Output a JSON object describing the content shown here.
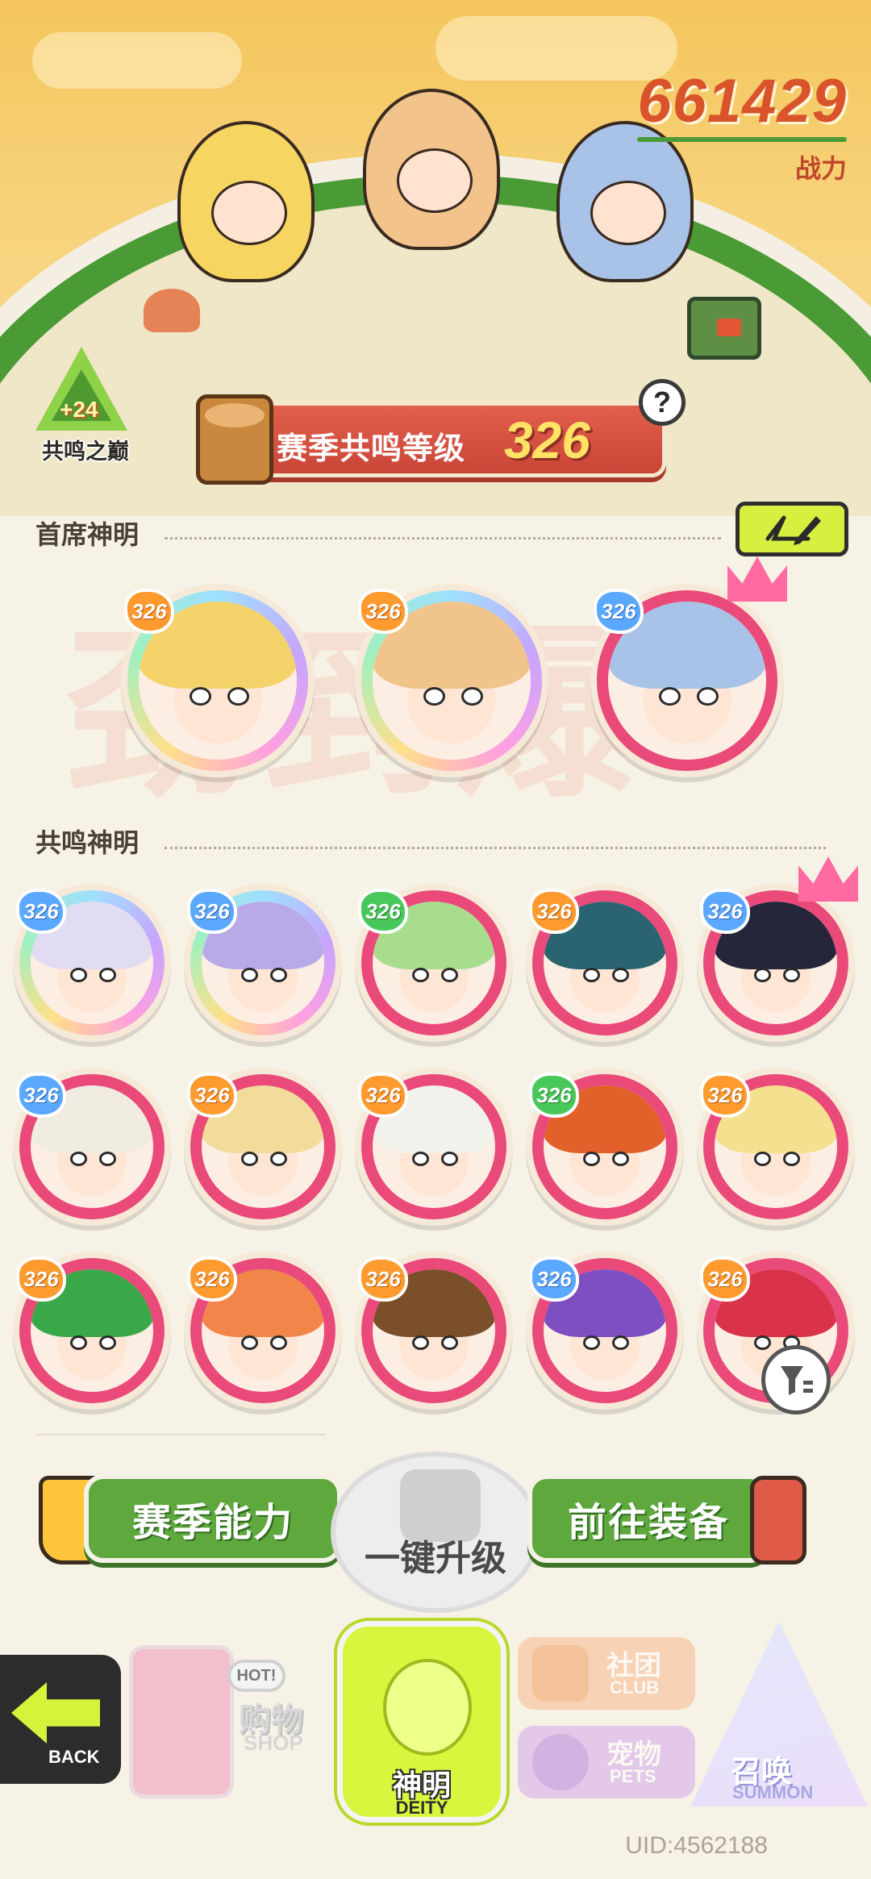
{
  "header": {
    "combat_power": "661429",
    "combat_power_label": "战力",
    "peak_badge_bonus": "+24",
    "peak_badge_label": "共鸣之巅",
    "resonance_label": "赛季共鸣等级",
    "resonance_level": "326",
    "help_symbol": "?"
  },
  "sections": {
    "chief_title": "首席神明",
    "resonance_title": "共鸣神明",
    "watermark": "劲到爆"
  },
  "chief_cards": [
    {
      "level": "326",
      "style": "rainbow",
      "badge": "orange",
      "hair": "#f4d36b",
      "crown": false
    },
    {
      "level": "326",
      "style": "rainbow",
      "badge": "orange",
      "hair": "#f0c48a",
      "crown": false
    },
    {
      "level": "326",
      "style": "pink",
      "badge": "blue",
      "hair": "#a9c3e8",
      "crown": true
    }
  ],
  "resonance_cards": [
    {
      "level": "326",
      "style": "rainbow",
      "badge": "blue",
      "hair": "#e2dcf2",
      "crown": false
    },
    {
      "level": "326",
      "style": "rainbow",
      "badge": "blue",
      "hair": "#b9a9e6",
      "crown": false
    },
    {
      "level": "326",
      "style": "pink",
      "badge": "green",
      "hair": "#a8dd8e",
      "crown": false
    },
    {
      "level": "326",
      "style": "pink",
      "badge": "orange",
      "hair": "#2a6470",
      "crown": false
    },
    {
      "level": "326",
      "style": "pink",
      "badge": "blue",
      "hair": "#25263a",
      "crown": true
    },
    {
      "level": "326",
      "style": "pink",
      "badge": "blue",
      "hair": "#f0ece2",
      "crown": false
    },
    {
      "level": "326",
      "style": "pink",
      "badge": "orange",
      "hair": "#f1dc9c",
      "crown": false
    },
    {
      "level": "326",
      "style": "pink",
      "badge": "orange",
      "hair": "#f2f2ec",
      "crown": false
    },
    {
      "level": "326",
      "style": "pink",
      "badge": "green",
      "hair": "#e2612a",
      "crown": false
    },
    {
      "level": "326",
      "style": "pink",
      "badge": "orange",
      "hair": "#f4e08f",
      "crown": false
    },
    {
      "level": "326",
      "style": "pink",
      "badge": "orange",
      "hair": "#3aa848",
      "crown": false
    },
    {
      "level": "326",
      "style": "pink",
      "badge": "orange",
      "hair": "#f2854a",
      "crown": false
    },
    {
      "level": "326",
      "style": "pink",
      "badge": "orange",
      "hair": "#7a4f2a",
      "crown": false
    },
    {
      "level": "326",
      "style": "pink",
      "badge": "blue",
      "hair": "#7d4fc0",
      "crown": false
    },
    {
      "level": "326",
      "style": "pink",
      "badge": "orange",
      "hair": "#d9324a",
      "crown": false
    }
  ],
  "actions": {
    "season_ability": "赛季能力",
    "one_click_upgrade": "一键升级",
    "go_equip": "前往装备"
  },
  "nav": {
    "back": "BACK",
    "shop_hot": "HOT!",
    "shop_cn": "购物",
    "shop_en": "SHOP",
    "deity_cn": "神明",
    "deity_en": "DEITY",
    "club_cn": "社团",
    "club_en": "CLUB",
    "pets_cn": "宠物",
    "pets_en": "PETS",
    "summon_cn": "召唤",
    "summon_en": "SUMMON"
  },
  "footer": {
    "uid": "UID:4562188"
  },
  "colors": {
    "accent_red": "#d9524a",
    "accent_green": "#5ea83e",
    "lime": "#d8f63e",
    "card_pink": "#e94a7a"
  }
}
